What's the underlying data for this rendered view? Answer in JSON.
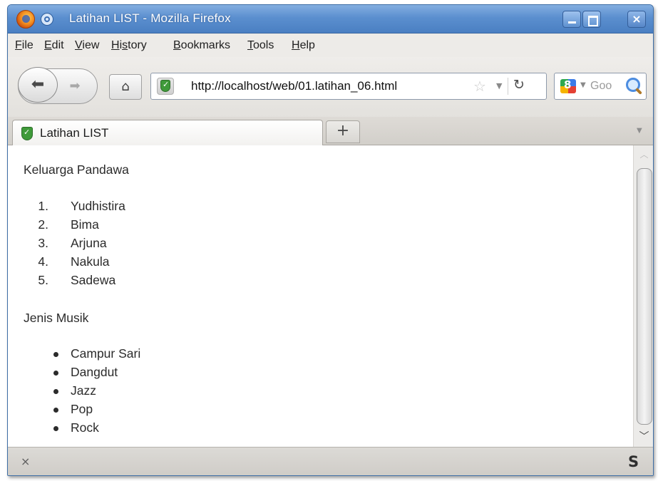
{
  "window": {
    "title": "Latihan LIST - Mozilla Firefox"
  },
  "menu": {
    "file": "File",
    "edit": "Edit",
    "view": "View",
    "history_a": "Hi",
    "history_u": "s",
    "history_b": "tory",
    "bookmarks": "Bookmarks",
    "tools": "Tools",
    "help": "Help"
  },
  "toolbar": {
    "url": "http://localhost/web/01.latihan_06.html",
    "search_placeholder": "Goo"
  },
  "tabs": [
    {
      "label": "Latihan LIST"
    }
  ],
  "page": {
    "ordered_heading": "Keluarga Pandawa",
    "ordered_items": [
      {
        "num": "1.",
        "text": "Yudhistira"
      },
      {
        "num": "2.",
        "text": "Bima"
      },
      {
        "num": "3.",
        "text": "Arjuna"
      },
      {
        "num": "4.",
        "text": "Nakula"
      },
      {
        "num": "5.",
        "text": "Sadewa"
      }
    ],
    "unordered_heading": "Jenis Musik",
    "unordered_items": [
      "Campur Sari",
      "Dangdut",
      "Jazz",
      "Pop",
      "Rock"
    ]
  },
  "icons": {
    "close": "×",
    "status": "S"
  },
  "colors": {
    "titlebar": "#5b8fcf",
    "shield_green": "#3f9a3a"
  }
}
